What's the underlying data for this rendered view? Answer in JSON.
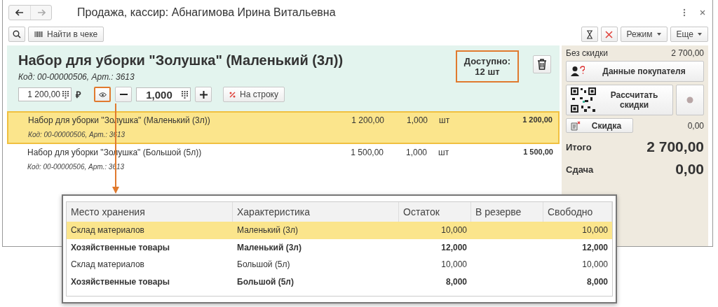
{
  "window": {
    "title": "Продажа, кассир: Абнагимова Ирина Витальевна"
  },
  "toolbar": {
    "find_button": "Найти в чеке",
    "mode_button": "Режим",
    "more_button": "Еще"
  },
  "product": {
    "name": "Набор для уборки \"Золушка\" (Маленький (3л))",
    "code": "Код: 00-00000506, Арт.: 3613",
    "price": "1 200,00",
    "currency": "₽",
    "quantity": "1,000",
    "discount_button": "На строку",
    "available_label": "Доступно:",
    "available_value": "12 шт"
  },
  "lines": [
    {
      "name": "Набор для уборки \"Золушка\" (Маленький (3л))",
      "code": "Код: 00-00000506, Арт.: 3613",
      "price": "1 200,00",
      "quantity": "1,000",
      "unit": "шт",
      "sum": "1 200,00",
      "selected": true
    },
    {
      "name": "Набор для уборки \"Золушка\" (Большой (5л))",
      "code": "Код: 00-00000506, Арт.: 3613",
      "price": "1 500,00",
      "quantity": "1,000",
      "unit": "шт",
      "sum": "1 500,00",
      "selected": false
    }
  ],
  "summary": {
    "no_discount_label": "Без скидки",
    "no_discount_value": "2 700,00",
    "customer_button": "Данные покупателя",
    "calc_button": "Рассчитать скидки",
    "discount_button": "Скидка",
    "discount_value": "0,00",
    "total_label": "Итого",
    "total_value": "2 700,00",
    "change_label": "Сдача",
    "change_value": "0,00"
  },
  "stock_popup": {
    "columns": [
      "Место хранения",
      "Характеристика",
      "Остаток",
      "В резерве",
      "Свободно"
    ],
    "rows": [
      {
        "place": "Склад материалов",
        "variant": "Маленький (3л)",
        "remain": "10,000",
        "free": "10,000",
        "bold": false,
        "selected": true
      },
      {
        "place": "Хозяйственные товары",
        "variant": "Маленький (3л)",
        "remain": "12,000",
        "free": "12,000",
        "bold": true,
        "selected": false
      },
      {
        "place": "Склад материалов",
        "variant": "Большой (5л)",
        "remain": "10,000",
        "free": "10,000",
        "bold": false,
        "selected": false
      },
      {
        "place": "Хозяйственные товары",
        "variant": "Большой (5л)",
        "remain": "8,000",
        "free": "8,000",
        "bold": true,
        "selected": false
      }
    ]
  }
}
